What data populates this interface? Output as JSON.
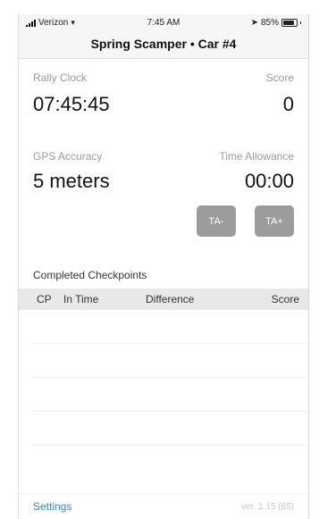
{
  "status_bar": {
    "carrier": "Verizon",
    "time": "7:45 AM",
    "battery": "85%"
  },
  "nav": {
    "title": "Spring Scamper • Car #4"
  },
  "rally_clock": {
    "label": "Rally Clock",
    "value": "07:45:45"
  },
  "score": {
    "label": "Score",
    "value": "0"
  },
  "gps_accuracy": {
    "label": "GPS Accuracy",
    "value": "5 meters"
  },
  "time_allowance": {
    "label": "Time Allowance",
    "value": "00:00"
  },
  "buttons": {
    "ta_minus": "TA-",
    "ta_plus": "TA+"
  },
  "checkpoints": {
    "title": "Completed Checkpoints",
    "columns": [
      "CP",
      "In Time",
      "Difference",
      "Score"
    ]
  },
  "footer": {
    "settings": "Settings",
    "version": "ver. 1.15 (85)"
  }
}
